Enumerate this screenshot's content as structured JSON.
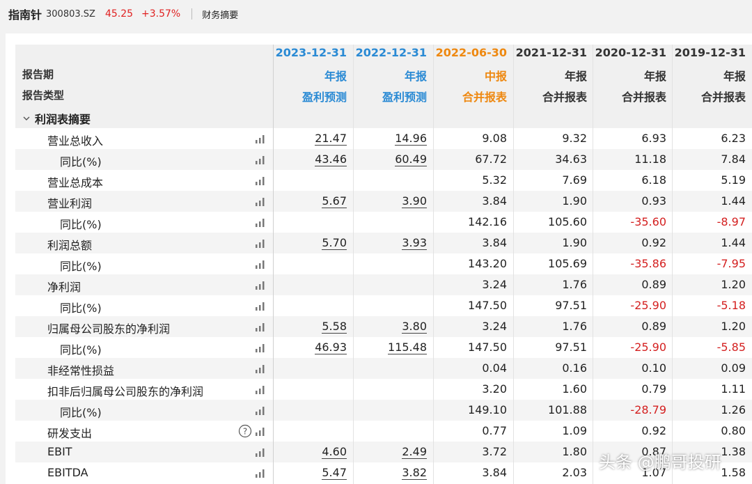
{
  "header": {
    "stock_name": "指南针",
    "stock_code": "300803.SZ",
    "price": "45.25",
    "change": "+3.57%",
    "tab": "财务摘要"
  },
  "table": {
    "row_labels": {
      "period": "报告期",
      "type": "报告类型"
    },
    "columns": [
      {
        "date": "2023-12-31",
        "period_type": "年报",
        "kind": "盈利预测",
        "color": "#2a8ad4"
      },
      {
        "date": "2022-12-31",
        "period_type": "年报",
        "kind": "盈利预测",
        "color": "#2a8ad4"
      },
      {
        "date": "2022-06-30",
        "period_type": "中报",
        "kind": "合并报表",
        "color": "#ee8810"
      },
      {
        "date": "2021-12-31",
        "period_type": "年报",
        "kind": "合并报表",
        "color": "#333333"
      },
      {
        "date": "2020-12-31",
        "period_type": "年报",
        "kind": "合并报表",
        "color": "#333333"
      },
      {
        "date": "2019-12-31",
        "period_type": "年报",
        "kind": "合并报表",
        "color": "#333333"
      }
    ],
    "section_title": "利润表摘要",
    "rows": [
      {
        "label": "营业总收入",
        "indent": 1,
        "values": [
          "21.47",
          "14.96",
          "9.08",
          "9.32",
          "6.93",
          "6.23"
        ]
      },
      {
        "label": "同比(%)",
        "indent": 2,
        "values": [
          "43.46",
          "60.49",
          "67.72",
          "34.63",
          "11.18",
          "7.84"
        ]
      },
      {
        "label": "营业总成本",
        "indent": 1,
        "values": [
          "",
          "",
          "5.32",
          "7.69",
          "6.18",
          "5.19"
        ]
      },
      {
        "label": "营业利润",
        "indent": 1,
        "values": [
          "5.67",
          "3.90",
          "3.84",
          "1.90",
          "0.93",
          "1.44"
        ]
      },
      {
        "label": "同比(%)",
        "indent": 2,
        "values": [
          "",
          "",
          "142.16",
          "105.60",
          "-35.60",
          "-8.97"
        ]
      },
      {
        "label": "利润总额",
        "indent": 1,
        "values": [
          "5.70",
          "3.93",
          "3.84",
          "1.90",
          "0.92",
          "1.44"
        ]
      },
      {
        "label": "同比(%)",
        "indent": 2,
        "values": [
          "",
          "",
          "143.20",
          "105.69",
          "-35.86",
          "-7.95"
        ]
      },
      {
        "label": "净利润",
        "indent": 1,
        "values": [
          "",
          "",
          "3.24",
          "1.76",
          "0.89",
          "1.20"
        ]
      },
      {
        "label": "同比(%)",
        "indent": 2,
        "values": [
          "",
          "",
          "147.50",
          "97.51",
          "-25.90",
          "-5.18"
        ]
      },
      {
        "label": "归属母公司股东的净利润",
        "indent": 1,
        "values": [
          "5.58",
          "3.80",
          "3.24",
          "1.76",
          "0.89",
          "1.20"
        ]
      },
      {
        "label": "同比(%)",
        "indent": 2,
        "values": [
          "46.93",
          "115.48",
          "147.50",
          "97.51",
          "-25.90",
          "-5.85"
        ]
      },
      {
        "label": "非经常性损益",
        "indent": 1,
        "values": [
          "",
          "",
          "0.04",
          "0.16",
          "0.10",
          "0.09"
        ]
      },
      {
        "label": "扣非后归属母公司股东的净利润",
        "indent": 1,
        "values": [
          "",
          "",
          "3.20",
          "1.60",
          "0.79",
          "1.11"
        ]
      },
      {
        "label": "同比(%)",
        "indent": 2,
        "values": [
          "",
          "",
          "149.10",
          "101.88",
          "-28.79",
          "1.26"
        ]
      },
      {
        "label": "研发支出",
        "indent": 1,
        "help": true,
        "values": [
          "",
          "",
          "0.77",
          "1.09",
          "0.92",
          "0.80"
        ]
      },
      {
        "label": "EBIT",
        "indent": 1,
        "values": [
          "4.60",
          "2.49",
          "3.72",
          "1.80",
          "0.87",
          "1.38"
        ]
      },
      {
        "label": "EBITDA",
        "indent": 1,
        "values": [
          "5.47",
          "3.82",
          "3.84",
          "2.03",
          "1.07",
          "1.58"
        ]
      }
    ],
    "negative_color": "#d42020"
  },
  "watermark": "头条 @鹏哥投研"
}
